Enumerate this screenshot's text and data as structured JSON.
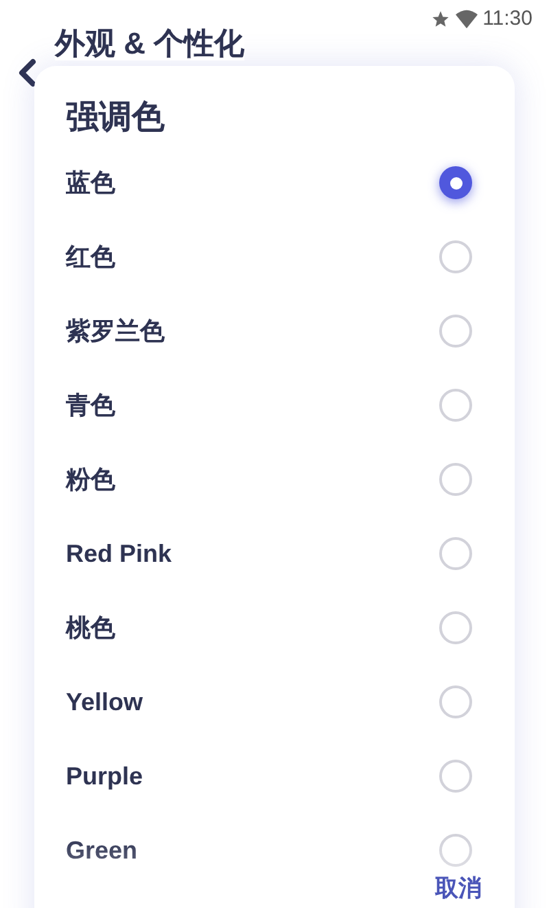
{
  "status_bar": {
    "time": "11:30"
  },
  "page": {
    "title": "外观 & 个性化"
  },
  "dialog": {
    "title": "强调色",
    "options": [
      {
        "label": "蓝色",
        "selected": true
      },
      {
        "label": "红色",
        "selected": false
      },
      {
        "label": "紫罗兰色",
        "selected": false
      },
      {
        "label": "青色",
        "selected": false
      },
      {
        "label": "粉色",
        "selected": false
      },
      {
        "label": "Red Pink",
        "selected": false
      },
      {
        "label": "桃色",
        "selected": false
      },
      {
        "label": "Yellow",
        "selected": false
      },
      {
        "label": "Purple",
        "selected": false
      },
      {
        "label": "Green",
        "selected": false
      }
    ],
    "cancel_button": "取消"
  }
}
